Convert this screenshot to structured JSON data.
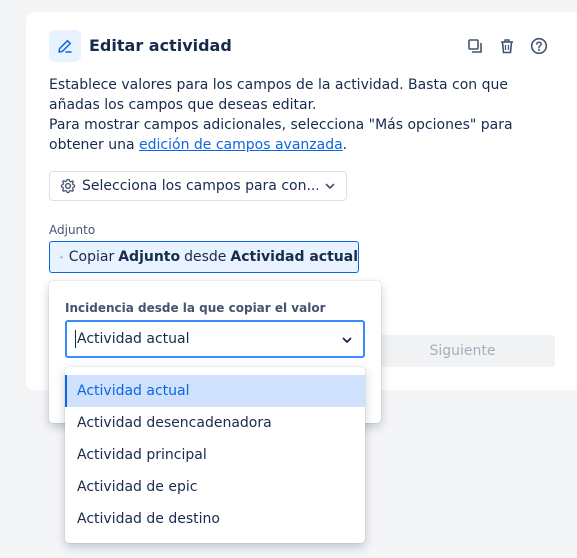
{
  "header": {
    "title": "Editar actividad",
    "icons": [
      "edit-icon",
      "duplicate-icon",
      "trash-icon",
      "help-icon"
    ]
  },
  "description": {
    "line1": "Establece valores para los campos de la actividad. Basta con que añadas los campos que deseas editar.",
    "line2_before": "Para mostrar campos adicionales, selecciona \"Más opciones\" para obtener una ",
    "line2_link": "edición de campos avanzada",
    "line2_after": "."
  },
  "field_select": {
    "label": "Selecciona los campos para con...",
    "icon": "gear-icon"
  },
  "attachment": {
    "label": "Adjunto",
    "button": {
      "prefix": "Copiar",
      "field": "Adjunto",
      "middle": "desde",
      "source": "Actividad actual"
    }
  },
  "next_button": "Siguiente",
  "popup": {
    "label": "Incidencia desde la que copiar el valor",
    "selected_value": "Actividad actual"
  },
  "menu": {
    "items": [
      {
        "label": "Actividad actual",
        "selected": true
      },
      {
        "label": "Actividad desencadenadora",
        "selected": false
      },
      {
        "label": "Actividad principal",
        "selected": false
      },
      {
        "label": "Actividad de epic",
        "selected": false
      },
      {
        "label": "Actividad de destino",
        "selected": false
      }
    ]
  },
  "colors": {
    "accent": "#0c66e4",
    "accent_light": "#e9f2ff",
    "text": "#172b4d",
    "subtle_text": "#44546f",
    "disabled": "#a5adba"
  }
}
